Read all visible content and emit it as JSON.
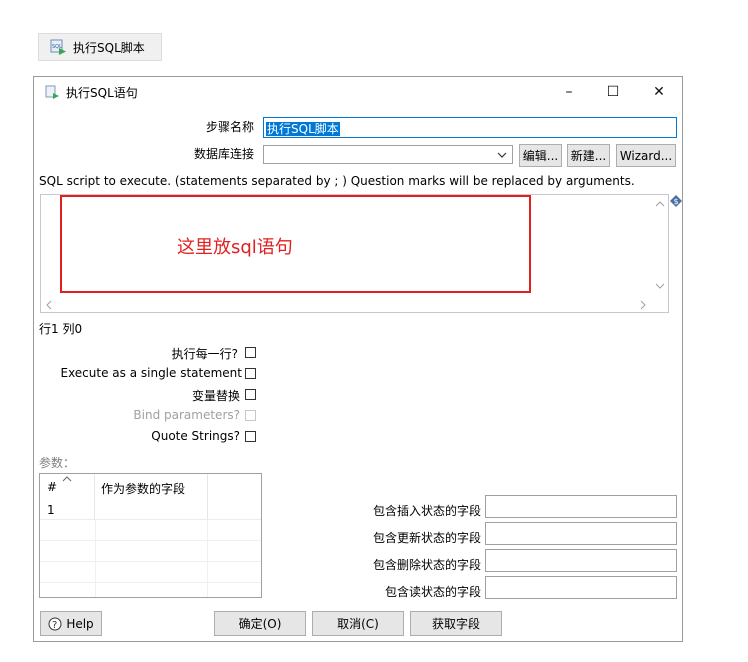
{
  "step_tab": {
    "label": "执行SQL脚本"
  },
  "dialog": {
    "title": "执行SQL语句",
    "minimize": "–",
    "maximize": "☐",
    "close": "✕"
  },
  "form": {
    "step_name_label": "步骤名称",
    "step_name_value": "执行SQL脚本",
    "connection_label": "数据库连接",
    "connection_value": "",
    "edit_button": "编辑...",
    "new_button": "新建...",
    "wizard_button": "Wizard...",
    "sql_hint": "SQL script to execute. (statements separated by ; ) Question marks will be replaced by arguments.",
    "sql_annotation": "这里放sql语句",
    "cursor_position": "行1 列0"
  },
  "options": {
    "execute_each_row": "执行每一行?",
    "single_statement": "Execute as a single statement",
    "variable_substitution": "变量替换",
    "bind_parameters": "Bind parameters?",
    "quote_strings": "Quote Strings?"
  },
  "params": {
    "label": "参数：",
    "col_num": "#",
    "col_field": "作为参数的字段",
    "rows": [
      {
        "num": "1",
        "field": ""
      }
    ]
  },
  "status_fields": {
    "insert_label": "包含插入状态的字段",
    "update_label": "包含更新状态的字段",
    "delete_label": "包含删除状态的字段",
    "read_label": "包含读状态的字段"
  },
  "footer": {
    "help": "Help",
    "ok": "确定(O)",
    "cancel": "取消(C)",
    "get_fields": "获取字段"
  },
  "colors": {
    "accent": "#0078d7",
    "annotation_red": "#e02020"
  }
}
